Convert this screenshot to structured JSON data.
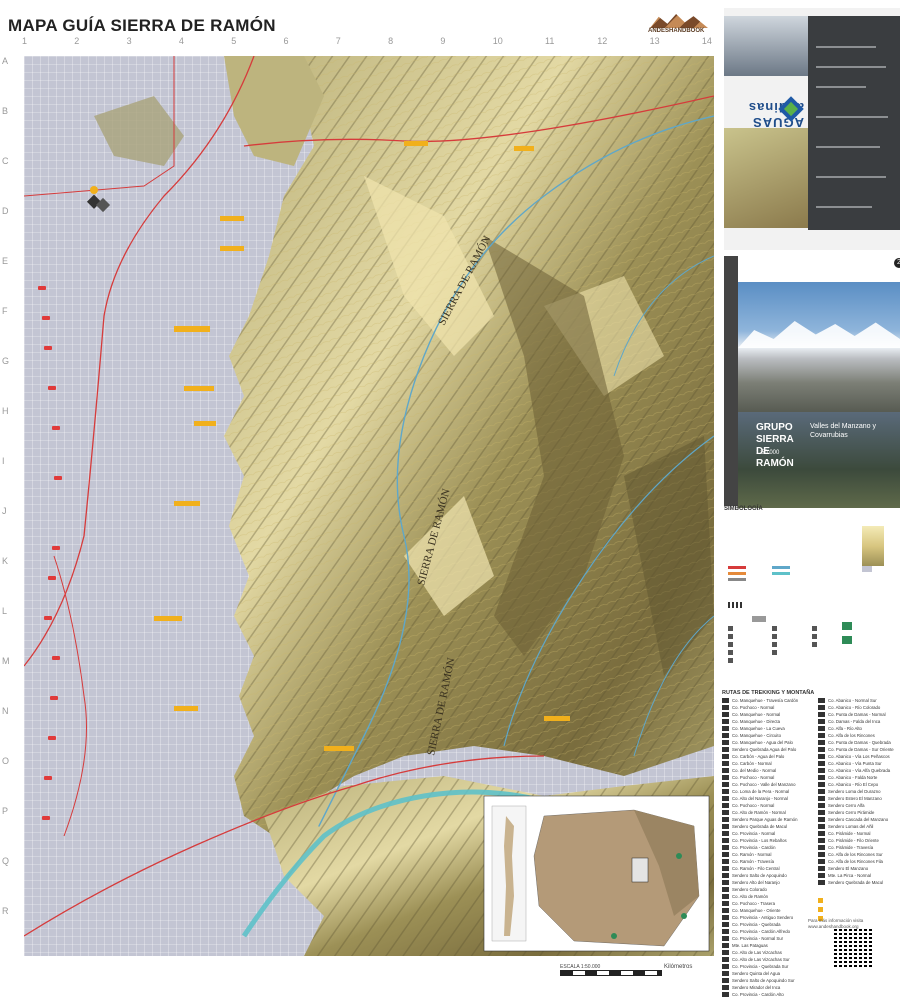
{
  "title": "MAPA GUÍA SIERRA DE RAMÓN",
  "brand": "ANDESHANDBOOK",
  "grid_columns": [
    "1",
    "2",
    "3",
    "4",
    "5",
    "6",
    "7",
    "8",
    "9",
    "10",
    "11",
    "12",
    "13",
    "14"
  ],
  "grid_rows": [
    "A",
    "B",
    "C",
    "D",
    "E",
    "F",
    "G",
    "H",
    "I",
    "J",
    "K",
    "L",
    "M",
    "N",
    "O",
    "P",
    "Q",
    "R"
  ],
  "map_labels": {
    "range1": "SIERRA DE RAMÓN",
    "range2": "SIERRA DE RAMÓN",
    "range3": "SIERRA DE RAMÓN"
  },
  "scale": "ESCALA 1:50.000",
  "scale_unit": "Kilómetros",
  "sponsor": "AGUAS andinas",
  "cover": {
    "title": "GRUPO SIERRA DE RAMÓN",
    "subtitle": "Valles del Manzano y Covarrubias",
    "scale": "1:50 000",
    "page": "2"
  },
  "legend_title": "SIMBOLOGÍA",
  "routes_title": "RUTAS DE TREKKING Y MONTAÑA",
  "routes_left": [
    "Co. Manquehue - Travesía Cardón",
    "Co. Pochoco - Normal",
    "Co. Manquehue - Normal",
    "Co. Manquehue - Directa",
    "Co. Manquehue - La Cueva",
    "Co. Manquehue - Circuito",
    "Co. Manquehue - Agua del Palo",
    "Sendero Quebrada Agua del Palo",
    "Co. Carbón - Agua del Palo",
    "Co. Carbón - Normal",
    "Co. del Medio - Normal",
    "Co. Pochoco - Normal",
    "Co. Pochoco - Valle del Manzano",
    "Co. Loma de la Pera - Normal",
    "Co. Alto del Naranjo - Normal",
    "Co. Pochoco - Normal",
    "Co. Alto de Ramón - Normal",
    "Sendero Parque Aguas de Ramón",
    "Sendero Quebrada de Macul",
    "Co. Provincia - Normal",
    "Co. Provincia - Los Rebaños",
    "Co. Provincia - Cardón",
    "Co. Ramón - Normal",
    "Co. Ramón - Travesía",
    "Co. Ramón - Filo Central",
    "Sendero Salto de Apoquindo",
    "Sendero Alto del Naranjo",
    "Sendero Colorado",
    "Co. Alto de Ramón",
    "Co. Pochoco - Trasera",
    "Co. Manquehue - Oriente",
    "Co. Provincia - Antiguo Sendero",
    "Co. Provincia - Quebrada",
    "Co. Provincia - Cardón Alfredo",
    "Co. Provincia - Normal Sur",
    "Mte. Las Pataguas",
    "Co. Alto de Las Vizcachas",
    "Co. Alto de Las Vizcachas Sur",
    "Co. Provincia - Quebrada Sur",
    "Sendero Quinta del Agua",
    "Sendero Salto de Apoquindo Sur",
    "Sendero Mirador del Inca",
    "Co. Provincia - Cardón Alto",
    "Co. Provincia - Directa",
    "Co. Ramón - Alto del Inca",
    "Sendero Peumos",
    "Sendero Pueblo Antiguo",
    "Co. Ramón - Filo Apoquindo",
    "Co. Ramón - Torrecilla",
    "Co. Abanico - Normal"
  ],
  "routes_right": [
    "Co. Abanico - Normal Sur",
    "Co. Abanico - Río Colorado",
    "Co. Punta de Damas - Normal",
    "Co. Damas - Falda del Inca",
    "Co. Alfa - Río Alto",
    "Co. Alfa de los Rincones",
    "Co. Punta de Damas - Quebrada",
    "Co. Punta de Damas - Sur Oriente",
    "Co. Abanico - Vía Los Peñascos",
    "Co. Abanico - Vía Punta Sur",
    "Co. Abanico - Vía Alfa Quebrada",
    "Co. Abanico - Falda Norte",
    "Co. Abanico - Río El Cepo",
    "Sendero Loma del Durazno",
    "Sendero Estero El Manzano",
    "Sendero Cerro Alfa",
    "Sendero Cerro Pirámide",
    "Sendero Cascada del Manzano",
    "Sendero Lomas del Añil",
    "Co. Pirámide - Normal",
    "Co. Pirámide - Filo Oriente",
    "Co. Pirámide - Travesía",
    "Co. Alfa de los Rincones Sur",
    "Co. Alfa de los Rincones Fila",
    "Sendero El Manzano",
    "Mte. La Pirca - Normal",
    "Sendero Quebrada de Macul"
  ],
  "contact": "Para más información visita www.andeshandbook.org"
}
